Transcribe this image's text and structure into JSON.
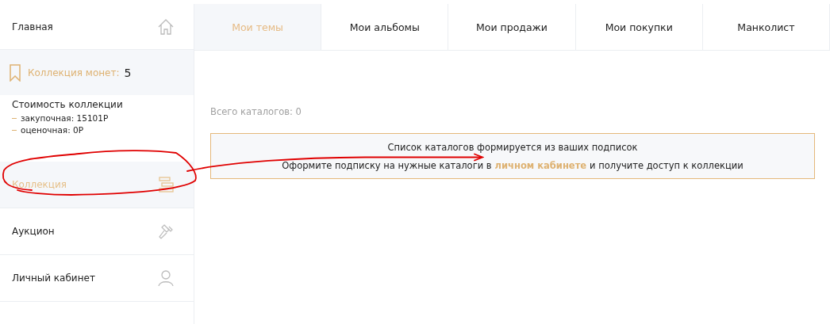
{
  "sidebar": {
    "home": {
      "label": "Главная"
    },
    "collection_summary": {
      "label": "Коллекция монет:",
      "count": "5"
    },
    "cost": {
      "title": "Стоимость коллекции",
      "lines": [
        "закупочная: 15101Р",
        "оценочная: 0Р"
      ]
    },
    "items": [
      {
        "label": "Коллекция",
        "selected": true
      },
      {
        "label": "Аукцион",
        "selected": false
      },
      {
        "label": "Личный кабинет",
        "selected": false
      }
    ]
  },
  "tabs": [
    {
      "label": "Мои темы",
      "selected": true
    },
    {
      "label": "Мои альбомы",
      "selected": false
    },
    {
      "label": "Мои продажи",
      "selected": false
    },
    {
      "label": "Мои покупки",
      "selected": false
    },
    {
      "label": "Манколист",
      "selected": false
    }
  ],
  "catalog_count": "Всего каталогов: 0",
  "notice": {
    "line_1": "Список каталогов формируется из ваших подписок",
    "line_2_before": "Оформите подписку на нужные каталоги в",
    "link": "личном кабинете",
    "line_2_after": "и получите доступ к коллекции"
  }
}
